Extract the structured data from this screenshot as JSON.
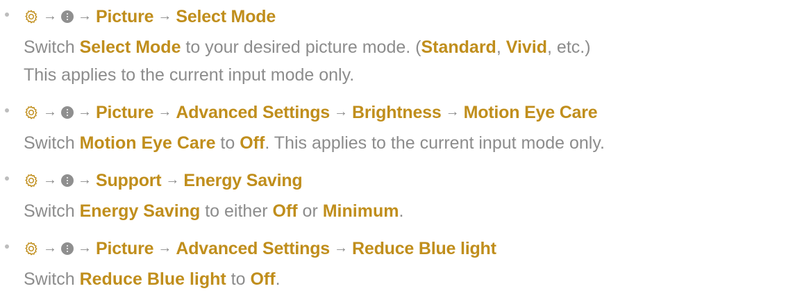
{
  "items": [
    {
      "path": [
        "Picture",
        "Select Mode"
      ],
      "desc_lines": [
        [
          {
            "t": "Switch "
          },
          {
            "t": "Select Mode",
            "b": true
          },
          {
            "t": " to your desired picture mode. ("
          },
          {
            "t": "Standard",
            "b": true
          },
          {
            "t": ", "
          },
          {
            "t": "Vivid",
            "b": true
          },
          {
            "t": ", etc.)"
          }
        ],
        [
          {
            "t": "This applies to the current input mode only."
          }
        ]
      ]
    },
    {
      "path": [
        "Picture",
        "Advanced Settings",
        "Brightness",
        "Motion Eye Care"
      ],
      "desc_lines": [
        [
          {
            "t": "Switch "
          },
          {
            "t": "Motion Eye Care",
            "b": true
          },
          {
            "t": " to "
          },
          {
            "t": "Off",
            "b": true
          },
          {
            "t": ". This applies to the current input mode only."
          }
        ]
      ]
    },
    {
      "path": [
        "Support",
        "Energy Saving"
      ],
      "desc_lines": [
        [
          {
            "t": "Switch "
          },
          {
            "t": "Energy Saving",
            "b": true
          },
          {
            "t": " to either "
          },
          {
            "t": "Off",
            "b": true
          },
          {
            "t": " or "
          },
          {
            "t": "Minimum",
            "b": true
          },
          {
            "t": "."
          }
        ]
      ]
    },
    {
      "path": [
        "Picture",
        "Advanced Settings",
        "Reduce Blue light"
      ],
      "desc_lines": [
        [
          {
            "t": "Switch "
          },
          {
            "t": "Reduce Blue light",
            "b": true
          },
          {
            "t": " to "
          },
          {
            "t": "Off",
            "b": true
          },
          {
            "t": "."
          }
        ]
      ]
    }
  ],
  "arrow_glyph": "→",
  "icons": [
    "settings-gear-icon",
    "all-settings-dots-icon"
  ],
  "colors": {
    "accent": "#c08e1c",
    "text": "#8c8c8c",
    "icon": "#8f8f8f"
  }
}
